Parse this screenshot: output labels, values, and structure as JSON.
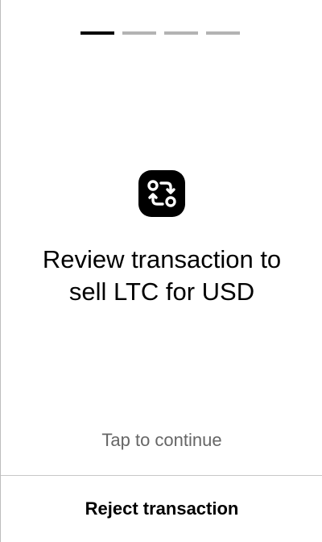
{
  "progress": {
    "total_steps": 4,
    "current_step": 1
  },
  "icon": "swap-arrows-icon",
  "title": {
    "line1": "Review transaction to",
    "line2": "sell LTC for USD"
  },
  "tap_hint": "Tap to continue",
  "reject_label": "Reject transaction",
  "colors": {
    "primary": "#000000",
    "inactive_step": "#b3b3b3",
    "hint_text": "#666666",
    "divider": "#c8c8c8"
  }
}
